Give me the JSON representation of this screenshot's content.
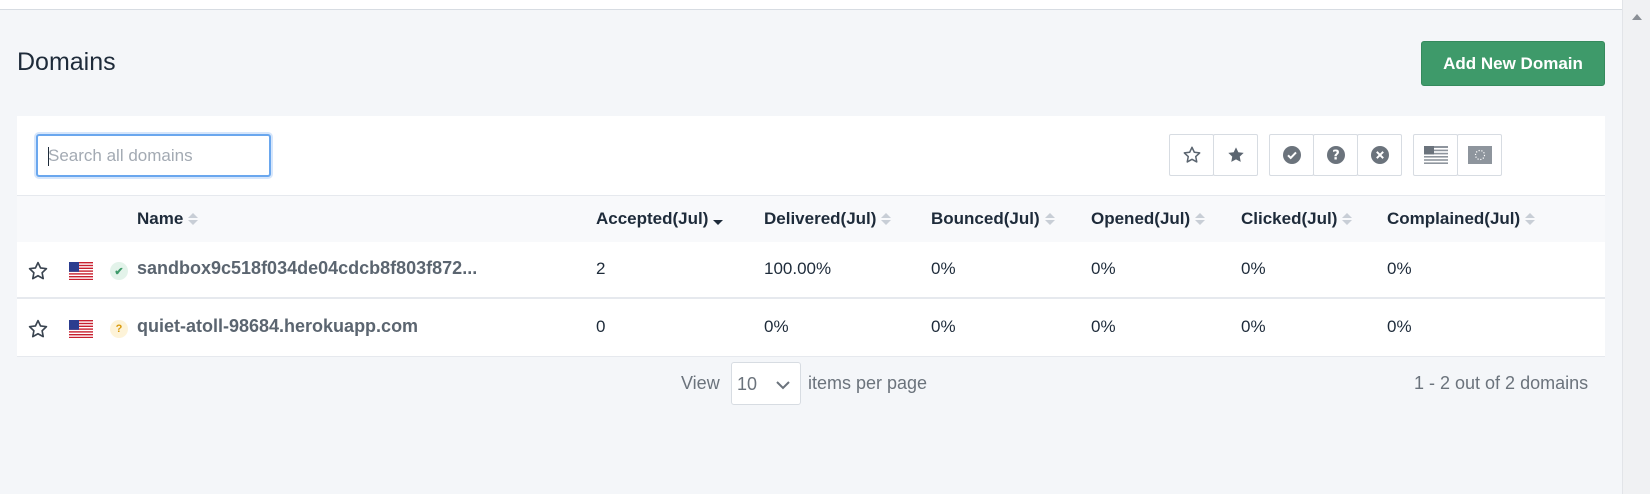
{
  "page": {
    "title": "Domains",
    "add_button": "Add New Domain"
  },
  "search": {
    "placeholder": "Search all domains",
    "value": ""
  },
  "filters": [
    {
      "name": "star-outline-filter",
      "icon": "star-outline-icon"
    },
    {
      "name": "star-filled-filter",
      "icon": "star-filled-icon"
    },
    {
      "name": "verified-filter",
      "icon": "check-circle-icon"
    },
    {
      "name": "unverified-filter",
      "icon": "question-circle-icon"
    },
    {
      "name": "failed-filter",
      "icon": "x-circle-icon"
    },
    {
      "name": "us-region-filter",
      "icon": "us-flag-icon"
    },
    {
      "name": "eu-region-filter",
      "icon": "eu-flag-icon"
    }
  ],
  "table": {
    "columns": {
      "name": "Name",
      "accepted": "Accepted(Jul)",
      "delivered": "Delivered(Jul)",
      "bounced": "Bounced(Jul)",
      "opened": "Opened(Jul)",
      "clicked": "Clicked(Jul)",
      "complained": "Complained(Jul)"
    },
    "sorted_column": "accepted",
    "sort_direction": "desc",
    "rows": [
      {
        "name": "sandbox9c518f034de04cdcb8f803f872...",
        "status": "verified",
        "status_icon": "check-icon",
        "region": "us-flag-icon",
        "accepted": "2",
        "delivered": "100.00%",
        "bounced": "0%",
        "opened": "0%",
        "clicked": "0%",
        "complained": "0%"
      },
      {
        "name": "quiet-atoll-98684.herokuapp.com",
        "status": "unverified",
        "status_icon": "question-icon",
        "region": "us-flag-icon",
        "accepted": "0",
        "delivered": "0%",
        "bounced": "0%",
        "opened": "0%",
        "clicked": "0%",
        "complained": "0%"
      }
    ]
  },
  "pagination": {
    "view_label": "View",
    "per_page": "10",
    "items_label": "items per page",
    "summary": "1 - 2 out of 2 domains"
  },
  "colors": {
    "accent": "#3e9a6a",
    "background": "#f4f6f9",
    "text": "#1e2b3a",
    "muted": "#6b737c"
  }
}
